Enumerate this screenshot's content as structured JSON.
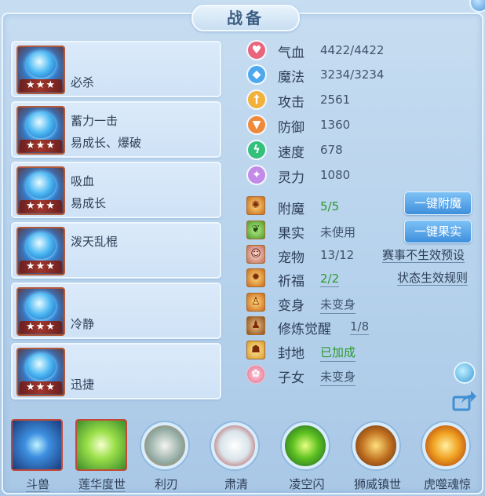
{
  "title": "战备",
  "skills": [
    {
      "line1": "",
      "line2": "必杀",
      "stars": "★★★"
    },
    {
      "line1": "蓄力一击",
      "line2": "易成长、爆破",
      "stars": "★★★"
    },
    {
      "line1": "吸血",
      "line2": "易成长",
      "stars": "★★★"
    },
    {
      "line1": "泼天乱棍",
      "line2": "",
      "stars": "★★★"
    },
    {
      "line1": "",
      "line2": "冷静",
      "stars": "★★★"
    },
    {
      "line1": "",
      "line2": "迅捷",
      "stars": "★★★"
    }
  ],
  "stats": [
    {
      "name": "气血",
      "value": "4422/4422",
      "color": "#e8657c"
    },
    {
      "name": "魔法",
      "value": "3234/3234",
      "color": "#4ea8ee"
    },
    {
      "name": "攻击",
      "value": "2561",
      "color": "#f2b13a"
    },
    {
      "name": "防御",
      "value": "1360",
      "color": "#ee8a3a"
    },
    {
      "name": "速度",
      "value": "678",
      "color": "#33c07a"
    },
    {
      "name": "灵力",
      "value": "1080",
      "color": "#c48ae8"
    }
  ],
  "equip": {
    "fumo": {
      "name": "附魔",
      "value": "5/5"
    },
    "guoshi": {
      "name": "果实",
      "value": "未使用"
    },
    "chongwu": {
      "name": "宠物",
      "value": "13/12"
    },
    "qifu": {
      "name": "祈福",
      "value": "2/2"
    },
    "bianshen": {
      "name": "变身",
      "value": "未变身"
    },
    "xiulian": {
      "name": "修炼觉醒",
      "value": "1/8"
    },
    "fengdi": {
      "name": "封地",
      "value": "已加成"
    },
    "zinv": {
      "name": "子女",
      "value": "未变身"
    }
  },
  "buttons": {
    "fumo": "一键附魔",
    "guoshi": "一键果实"
  },
  "links": {
    "saishi": "赛事不生效预设",
    "zhuangtai": "状态生效规则"
  },
  "bottom": [
    {
      "label": "斗兽"
    },
    {
      "label": "莲华度世"
    },
    {
      "label": "利刃"
    },
    {
      "label": "肃清"
    },
    {
      "label": "凌空闪"
    },
    {
      "label": "狮威镇世"
    },
    {
      "label": "虎噬魂惊"
    }
  ]
}
